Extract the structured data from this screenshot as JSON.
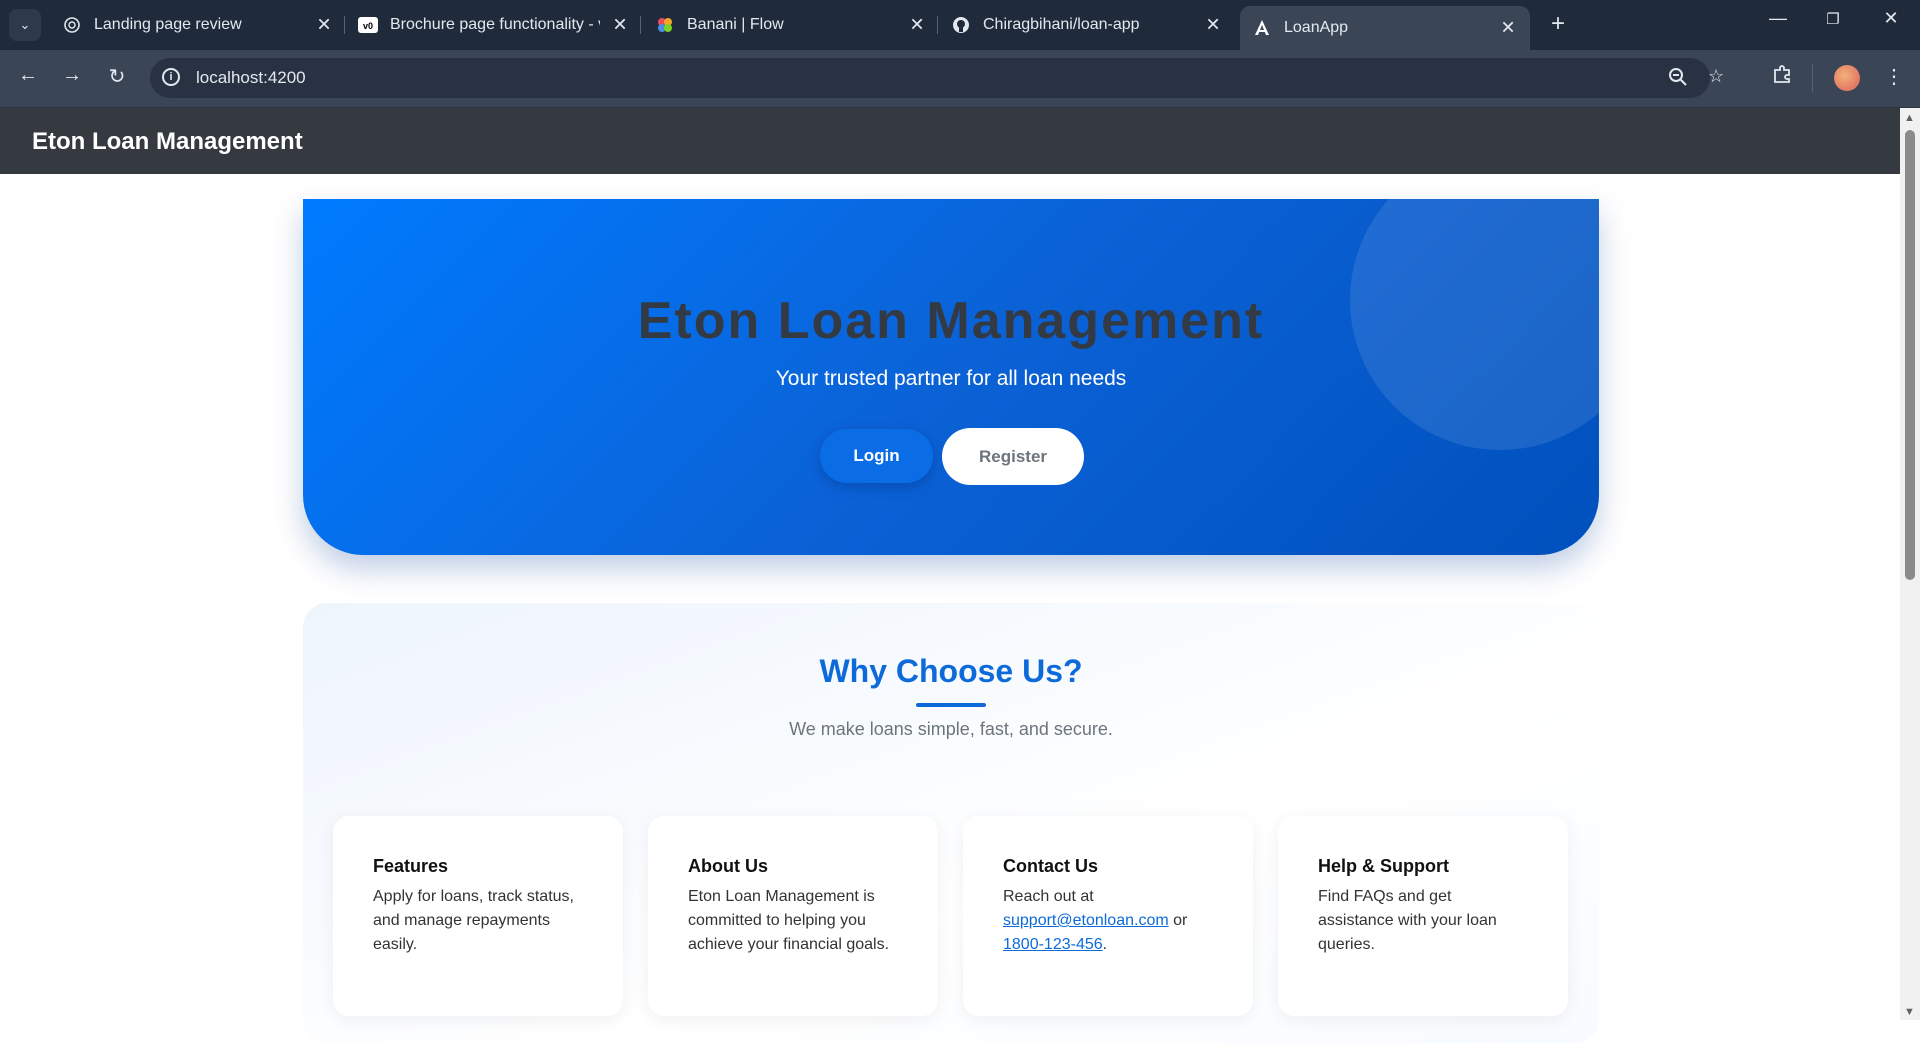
{
  "browser": {
    "tabs": [
      {
        "title": "Landing page review",
        "icon": "chatgpt-icon"
      },
      {
        "title": "Brochure page functionality - v0",
        "icon": "v0-icon"
      },
      {
        "title": "Banani | Flow",
        "icon": "banani-icon"
      },
      {
        "title": "Chiragbihani/loan-app",
        "icon": "github-icon"
      },
      {
        "title": "LoanApp",
        "icon": "angular-icon"
      }
    ],
    "url": "localhost:4200"
  },
  "header": {
    "title": "Eton Loan Management"
  },
  "hero": {
    "title": "Eton Loan Management",
    "subtitle": "Your trusted partner for all loan needs",
    "login_label": "Login",
    "register_label": "Register"
  },
  "why": {
    "title": "Why Choose Us?",
    "subtitle": "We make loans simple, fast, and secure."
  },
  "cards": [
    {
      "title": "Features",
      "text": "Apply for loans, track status, and manage repayments easily."
    },
    {
      "title": "About Us",
      "text": "Eton Loan Management is committed to helping you achieve your financial goals."
    },
    {
      "title": "Contact Us",
      "text_prefix": "Reach out at ",
      "email": "support@etonloan.com",
      "text_mid": " or ",
      "phone": "1800-123-456",
      "text_suffix": "."
    },
    {
      "title": "Help & Support",
      "text": "Find FAQs and get assistance with your loan queries."
    }
  ],
  "colors": {
    "brand_blue": "#007bff",
    "header_dark": "#343a40",
    "accent_title": "#0d6bd9"
  }
}
